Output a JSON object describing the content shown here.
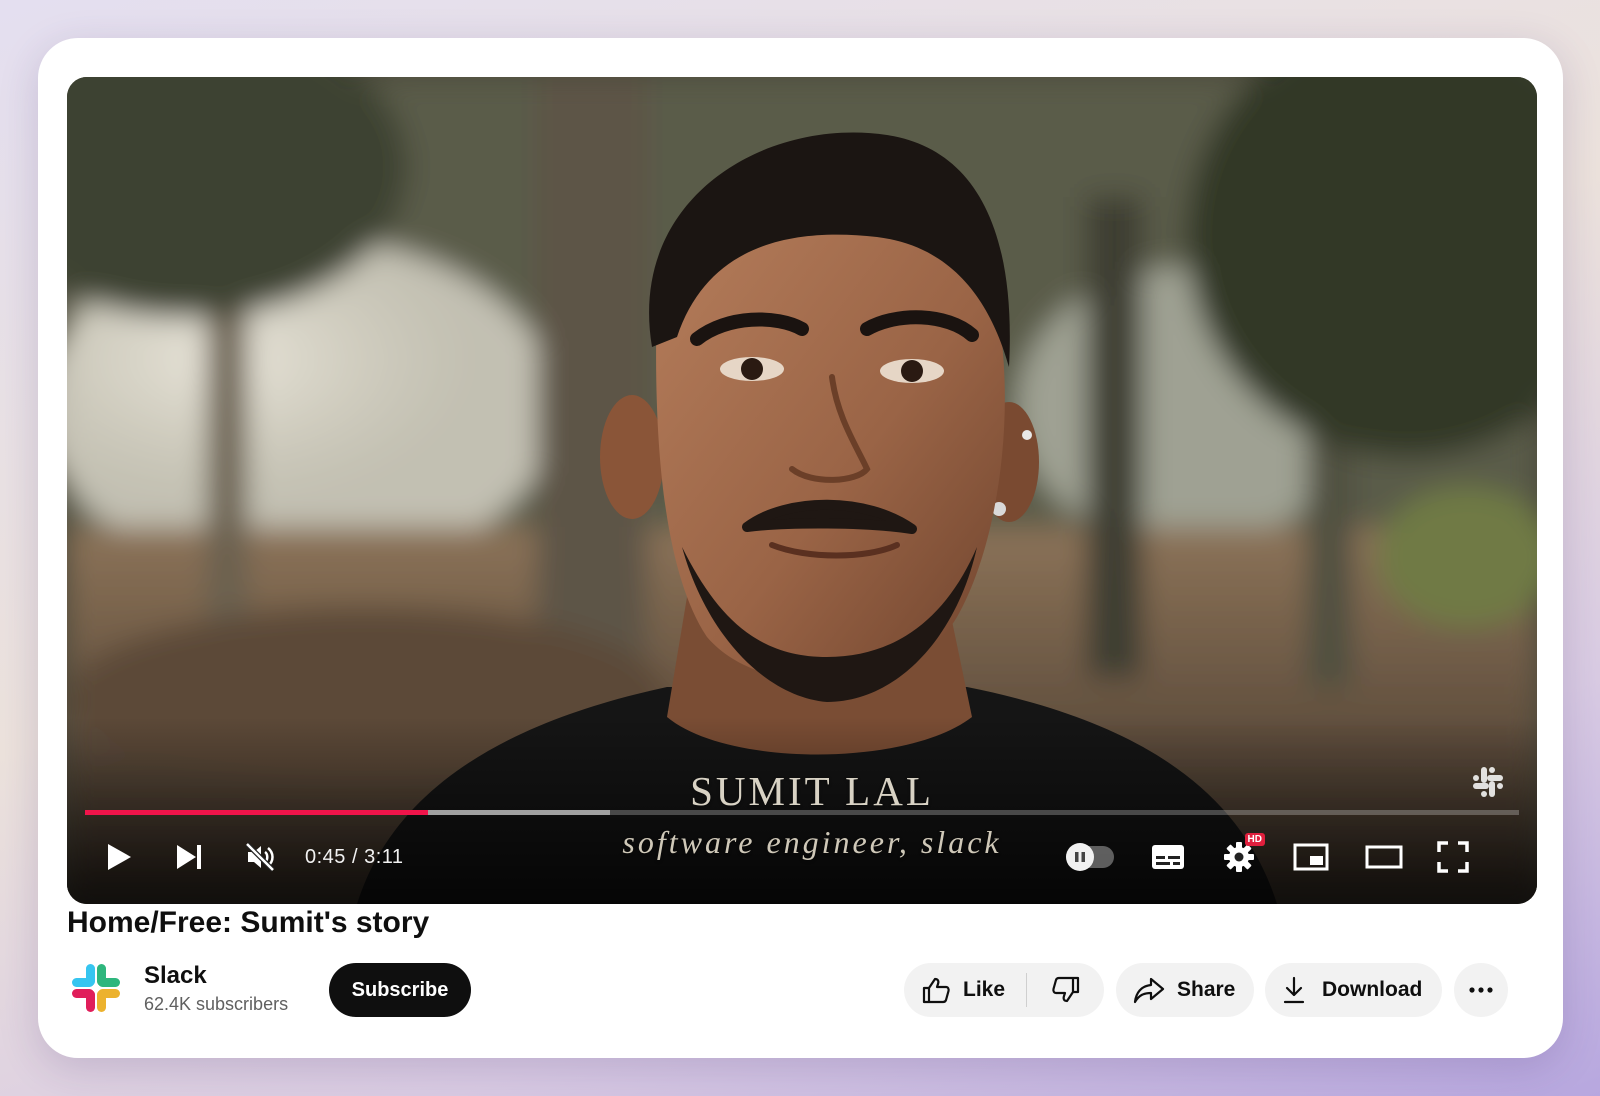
{
  "video": {
    "caption_name": "SUMIT LAL",
    "caption_role": "software engineer, slack",
    "progress_played": 0.239,
    "progress_buffered": 0.366,
    "time_display": "0:45 / 3:11",
    "hd_badge": "HD",
    "accent_color": "#f0144a"
  },
  "controls": {
    "icons": [
      "play-icon",
      "next-icon",
      "mute-icon",
      "autoplay-toggle",
      "subtitles-icon",
      "settings-icon",
      "miniplayer-icon",
      "theater-icon",
      "fullscreen-icon"
    ]
  },
  "title": "Home/Free: Sumit's story",
  "channel": {
    "name": "Slack",
    "subscribers": "62.4K subscribers",
    "brand_colors": [
      "#36c5f0",
      "#2eb67d",
      "#ecb22e",
      "#e01e5a"
    ]
  },
  "actions": {
    "subscribe": "Subscribe",
    "like": "Like",
    "share": "Share",
    "download": "Download"
  }
}
